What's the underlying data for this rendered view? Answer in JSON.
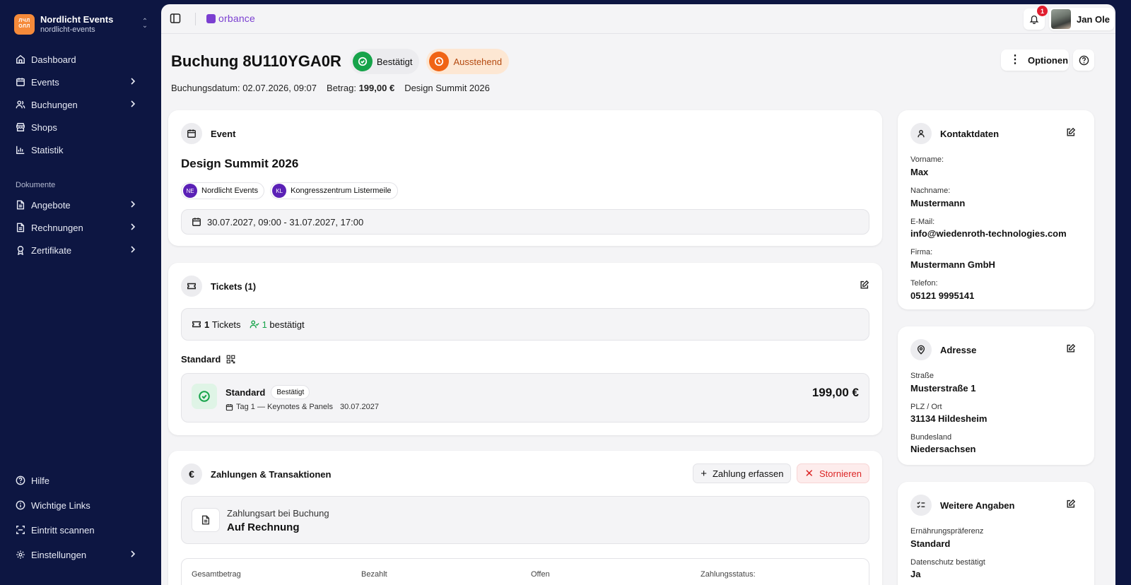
{
  "sidebar": {
    "org_name": "Nordlicht Events",
    "org_slug": "nordlicht-events",
    "logo_text_1": "ЛЧЛ",
    "logo_text_2": "ОЛЛ",
    "items": [
      {
        "label": "Dashboard",
        "icon": "home-icon"
      },
      {
        "label": "Events",
        "icon": "calendar-icon"
      },
      {
        "label": "Buchungen",
        "icon": "users-icon"
      },
      {
        "label": "Shops",
        "icon": "store-icon"
      },
      {
        "label": "Statistik",
        "icon": "chart-icon"
      }
    ],
    "section_label": "Dokumente",
    "doc_items": [
      {
        "label": "Angebote",
        "icon": "document-icon"
      },
      {
        "label": "Rechnungen",
        "icon": "document-icon"
      },
      {
        "label": "Zertifikate",
        "icon": "award-icon"
      }
    ],
    "bottom_items": [
      {
        "label": "Hilfe",
        "icon": "help-icon"
      },
      {
        "label": "Wichtige Links",
        "icon": "info-icon"
      },
      {
        "label": "Eintritt scannen",
        "icon": "scan-icon"
      },
      {
        "label": "Einstellungen",
        "icon": "settings-icon"
      }
    ]
  },
  "topbar": {
    "brand": "orbance",
    "notification_count": "1",
    "user_name": "Jan Ole"
  },
  "header": {
    "title": "Buchung 8U110YGA0R",
    "status_confirmed": "Bestätigt",
    "status_pending": "Ausstehend",
    "booking_date_label": "Buchungsdatum:",
    "booking_date": "02.07.2026, 09:07",
    "amount_label": "Betrag:",
    "amount": "199,00 €",
    "event_name": "Design Summit 2026",
    "options_label": "Optionen"
  },
  "event_card": {
    "title": "Event",
    "name": "Design Summit 2026",
    "chips": [
      {
        "initials": "NE",
        "label": "Nordlicht Events"
      },
      {
        "initials": "KL",
        "label": "Kongresszentrum Listermeile"
      }
    ],
    "date_range": "30.07.2027, 09:00 - 31.07.2027, 17:00"
  },
  "tickets_card": {
    "title": "Tickets (1)",
    "count": "1",
    "count_label": "Tickets",
    "confirmed_count": "1",
    "confirmed_label": "bestätigt",
    "category": "Standard",
    "ticket": {
      "name": "Standard",
      "badge": "Bestätigt",
      "session": "Tag 1 — Keynotes & Panels",
      "date": "30.07.2027",
      "price": "199,00 €"
    }
  },
  "payments_card": {
    "title": "Zahlungen & Transaktionen",
    "add_label": "Zahlung erfassen",
    "cancel_label": "Stornieren",
    "method_label": "Zahlungsart bei Buchung",
    "method_value": "Auf Rechnung",
    "summary_cols": [
      "Gesamtbetrag",
      "Bezahlt",
      "Offen",
      "Zahlungsstatus:"
    ]
  },
  "contact_card": {
    "title": "Kontaktdaten",
    "fields": [
      {
        "label": "Vorname:",
        "value": "Max"
      },
      {
        "label": "Nachname:",
        "value": "Mustermann"
      },
      {
        "label": "E-Mail:",
        "value": "info@wiedenroth-technologies.com"
      },
      {
        "label": "Firma:",
        "value": "Mustermann GmbH"
      },
      {
        "label": "Telefon:",
        "value": "05121 9995141"
      }
    ]
  },
  "address_card": {
    "title": "Adresse",
    "fields": [
      {
        "label": "Straße",
        "value": "Musterstraße 1"
      },
      {
        "label": "PLZ / Ort",
        "value": "31134 Hildesheim"
      },
      {
        "label": "Bundesland",
        "value": "Niedersachsen"
      }
    ]
  },
  "extra_card": {
    "title": "Weitere Angaben",
    "fields": [
      {
        "label": "Ernährungspräferenz",
        "value": "Standard"
      },
      {
        "label": "Datenschutz bestätigt",
        "value": "Ja"
      }
    ]
  },
  "colors": {
    "sidebar_bg": "#0d1642",
    "brand": "#7b3fd1",
    "success": "#16a34a",
    "warning": "#f06415",
    "danger": "#dc2626"
  }
}
